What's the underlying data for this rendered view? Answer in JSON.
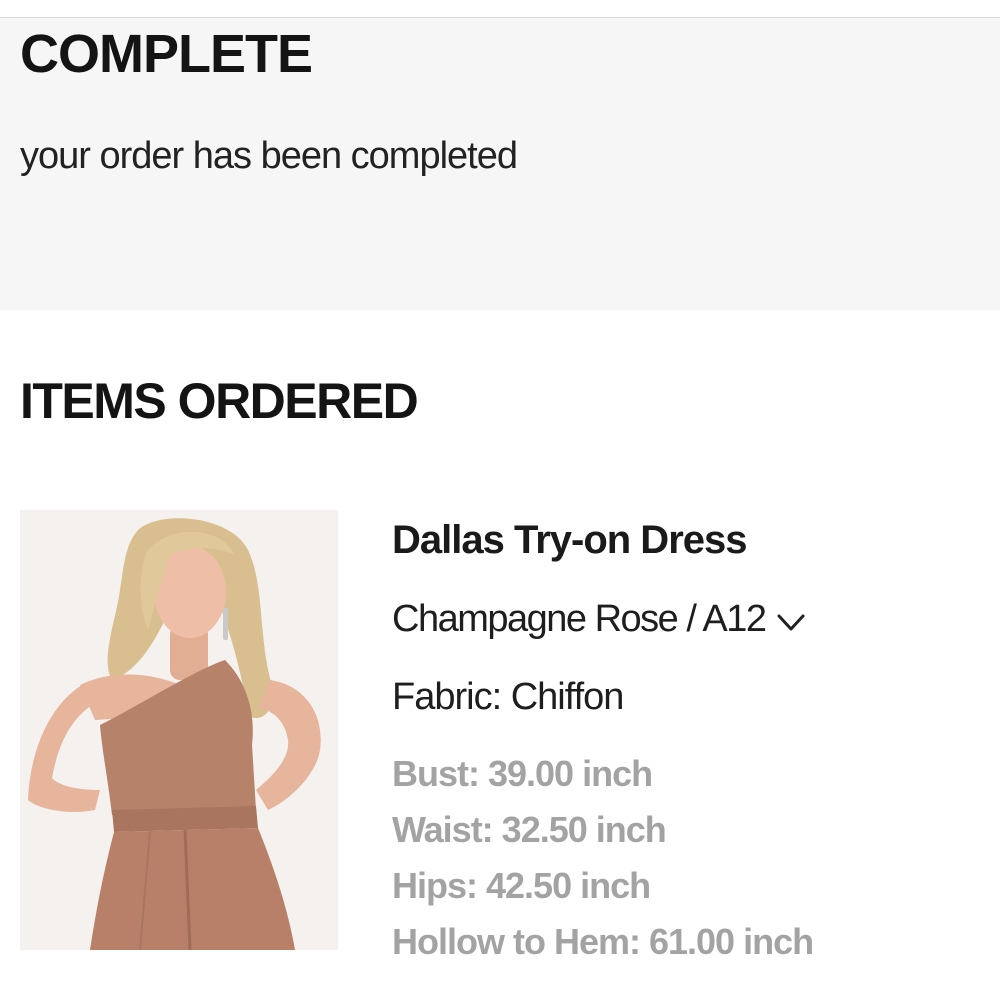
{
  "complete": {
    "title": "COMPLETE",
    "message": "your order has been completed"
  },
  "items_ordered": {
    "title": "ITEMS ORDERED",
    "items": [
      {
        "name": "Dallas Try-on Dress",
        "variant": "Champagne Rose / A12",
        "variant_icon": "chevron-down-icon",
        "fabric": "Fabric: Chiffon",
        "measurements": [
          "Bust: 39.00 inch",
          "Waist: 32.50 inch",
          "Hips: 42.50 inch",
          "Hollow to Hem: 61.00 inch"
        ],
        "image_colors": {
          "background": "#f4f1ef",
          "dress": "#b7826a",
          "skin": "#e8b9a0",
          "hair": "#d9bf8f"
        }
      }
    ]
  },
  "colors": {
    "panel_background": "#f6f6f6",
    "text_primary": "#1a1a1a",
    "text_muted": "#a3a3a3"
  }
}
